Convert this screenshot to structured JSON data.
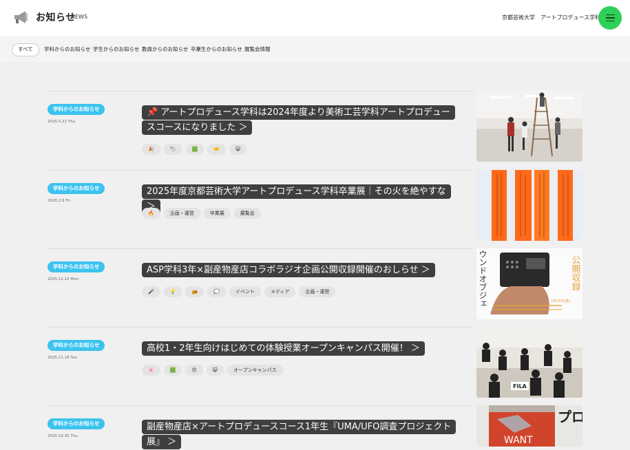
{
  "header": {
    "title": "お知らせ",
    "subtitle": "NEWS",
    "university": "京都芸術大学　アートプロデュース学科",
    "menu_icon": "hamburger-icon",
    "logo_icon": "megaphone-icon"
  },
  "filters": [
    {
      "label": "すべて"
    },
    {
      "label": "学科からのお知らせ"
    },
    {
      "label": "学生からのお知らせ"
    },
    {
      "label": "教員からのお知らせ"
    },
    {
      "label": "卒業生からのお知らせ"
    },
    {
      "label": "展覧会情報"
    }
  ],
  "news": [
    {
      "category": "学科からのお知らせ",
      "date": "2025.5.22 Thu.",
      "title": "📌 アートプロデュース学科は2024年度より美術工芸学科アートプロデュースコースになりました ＞",
      "tags": [
        "🎉",
        "🏷",
        "🟩",
        "🤝",
        "😺"
      ]
    },
    {
      "category": "学科からのお知らせ",
      "date": "2026.2.6 Fri.",
      "title": "2025年度京都芸術大学アートプロデュース学科卒業展｜その火を絶やすな ＞",
      "tags": [
        "🔥",
        "企画・運営",
        "卒業展",
        "展覧会"
      ]
    },
    {
      "category": "学科からのお知らせ",
      "date": "2025.12.22 Mon.",
      "title": "ASP学科3年×副産物産店コラボラジオ企画公開収録開催のおしらせ ＞",
      "tags": [
        "🎤",
        "💡",
        "📻",
        "💭",
        "イベント",
        "メディア",
        "企画・運営"
      ]
    },
    {
      "category": "学科からのお知らせ",
      "date": "2025.11.18 Tue.",
      "title": "高校1・2年生向けはじめての体験授業オープンキャンパス開催！ ＞",
      "tags": [
        "🌸",
        "🟩",
        "😊",
        "😺",
        "オープンキャンパス"
      ]
    },
    {
      "category": "学科からのお知らせ",
      "date": "2025.10.30 Thu.",
      "title": "副産物産店×アートプロデュースコース1年生『UMA/UFO調査プロジェクト展』 ＞",
      "tags": []
    }
  ],
  "thumb_texts": {
    "radio_right": "公開収録",
    "radio_left": "ウンドオブジェ",
    "radio_info": "2月26日(金)",
    "poster_text": "プロ",
    "poster_banner": "WANT"
  }
}
